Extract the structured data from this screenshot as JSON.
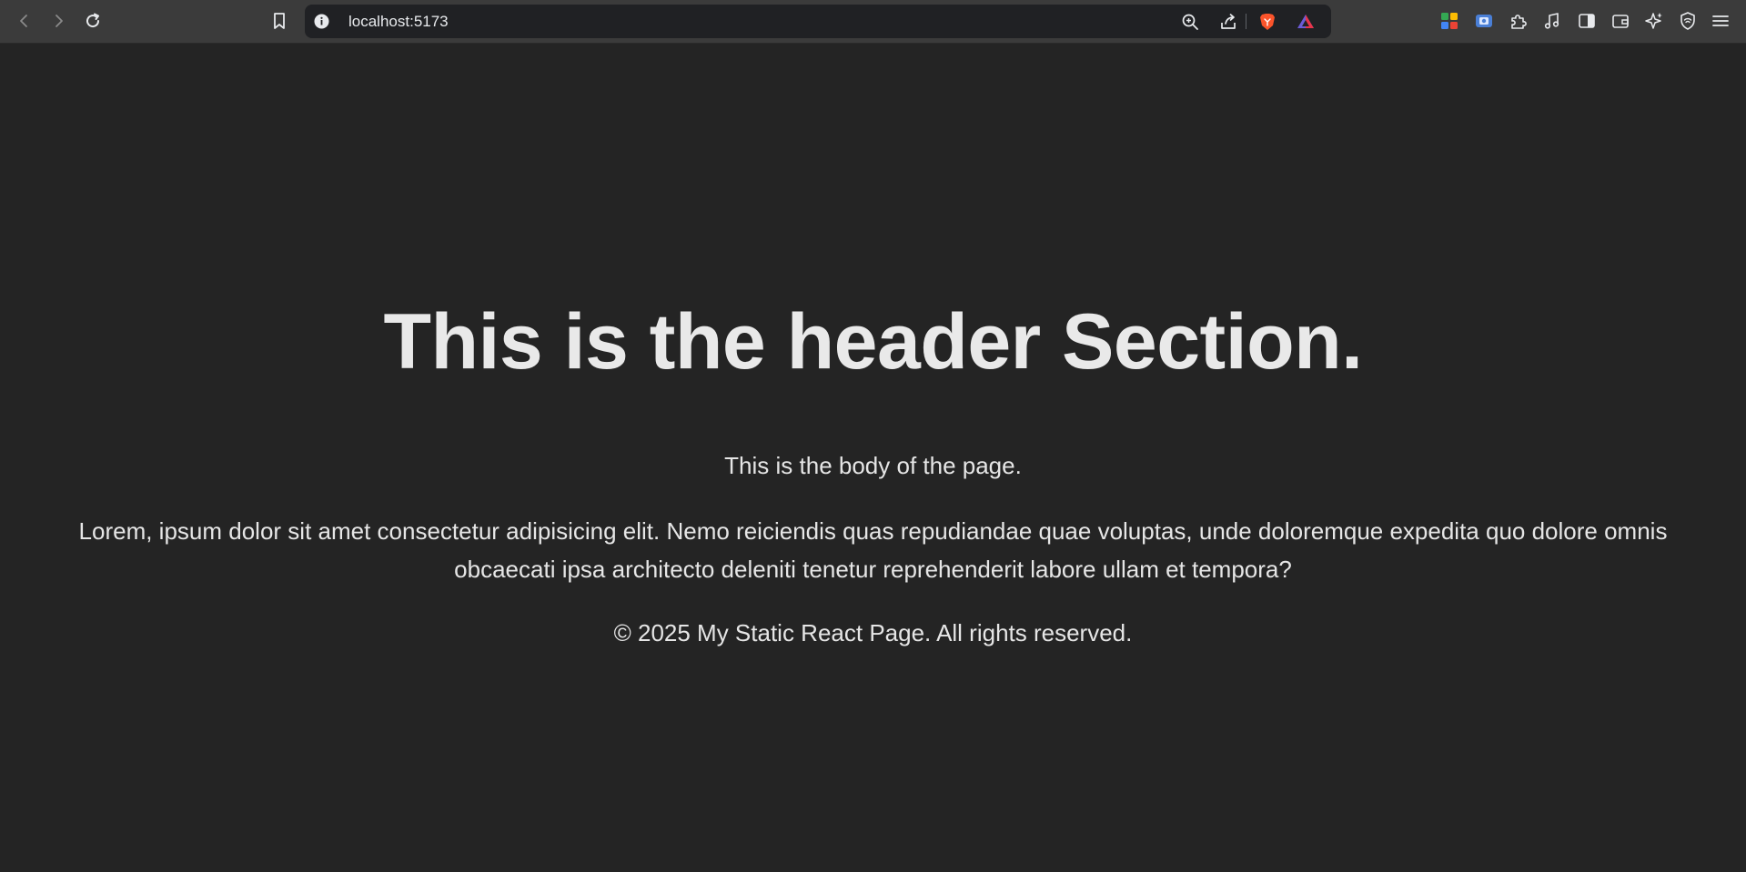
{
  "browser": {
    "url": "localhost:5173",
    "nav": {
      "back": "chevron-left-icon",
      "forward": "chevron-right-icon",
      "reload": "reload-icon",
      "bookmark": "bookmark-icon"
    },
    "url_actions": [
      "zoom-icon",
      "share-icon",
      "brave-shield-icon",
      "brave-rewards-icon"
    ],
    "extensions": [
      "sheets-extension-icon",
      "screen-capture-icon",
      "extensions-puzzle-icon",
      "music-icon",
      "sidebar-icon",
      "wallet-icon",
      "leo-ai-icon",
      "vpn-icon",
      "menu-icon"
    ],
    "accent": "#fb542b"
  },
  "page": {
    "title": "This is the header Section.",
    "body_intro": "This is the body of the page.",
    "lorem": "Lorem, ipsum dolor sit amet consectetur adipisicing elit. Nemo reiciendis quas repudiandae quae voluptas, unde doloremque expedita quo dolore omnis obcaecati ipsa architecto deleniti tenetur reprehenderit labore ullam et tempora?",
    "footer": "© 2025 My Static React Page. All rights reserved.",
    "background": "#242424"
  }
}
